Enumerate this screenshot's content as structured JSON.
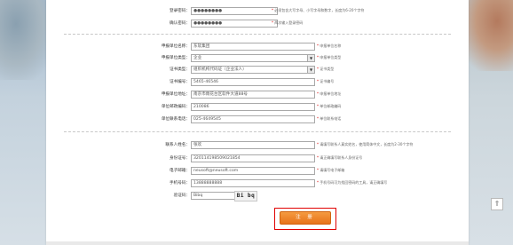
{
  "password": {
    "label": "登录密码：",
    "value": "●●●●●●●●",
    "hint_star": "*",
    "hint": "必须包含大写字母、小写字母和数字，长度为6-20个字符"
  },
  "confirm_password": {
    "label": "确认密码：",
    "value": "●●●●●●●●",
    "hint_star": "*",
    "hint": "两次输入登录密码"
  },
  "org": {
    "name_label": "申报单位名称：",
    "name_value": "东软集团",
    "name_hint": "申报单位名称",
    "type_label": "申报单位类型：",
    "type_value": "企业",
    "type_hint": "申报单位类型",
    "cert_type_label": "证书类型：",
    "cert_type_value": "组织机构代码证（企业法人）",
    "cert_type_hint": "证书类型",
    "cert_no_label": "证书编号：",
    "cert_no_value": "5465-46546",
    "cert_no_hint": "证书编号",
    "address_label": "申报单位地址：",
    "address_value": "南京市雨花台区软件大道88号",
    "address_hint": "申报单位地址",
    "postcode_label": "单位邮政编码：",
    "postcode_value": "210086",
    "postcode_hint": "单位邮政编码",
    "phone_label": "单位联系电话：",
    "phone_value": "025-4649545",
    "phone_hint": "单位联系电话"
  },
  "contact": {
    "name_label": "联系人姓名：",
    "name_value": "张欢",
    "name_hint": "请填写联系人真实姓名，使用简体中文，长度为2-30个字符",
    "id_label": "身份证号：",
    "id_value": "320114198509021854",
    "id_hint": "请正确填写联系人身份证号",
    "email_label": "电子邮箱：",
    "email_value": "neusoft@neusoft.com",
    "email_hint": "请填写电子邮箱",
    "mobile_label": "手机号码：",
    "mobile_value": "13888888888",
    "mobile_hint": "手机号码可为找回密码的工具，请正确填写",
    "captcha_label": "验证码：",
    "captcha_value": "Bibq",
    "captcha_image_text": "Bi bq"
  },
  "register_button": "注 册",
  "back_to_top": "⇑",
  "select_arrow": "▼"
}
